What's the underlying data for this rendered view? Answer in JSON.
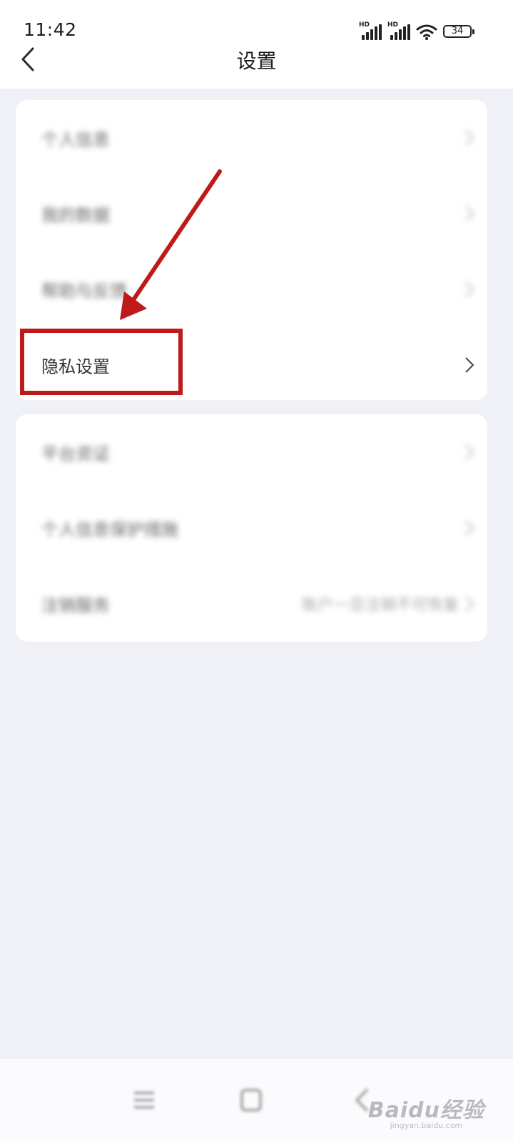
{
  "status_bar": {
    "time": "11:42",
    "battery": "34",
    "signal_label": "HD",
    "icons": [
      "hd-signal-icon",
      "hd-signal-icon",
      "wifi-icon",
      "battery-icon"
    ]
  },
  "header": {
    "title": "设置",
    "back_icon": "chevron-left-icon"
  },
  "settings": {
    "group1": [
      {
        "label": "个人信息"
      },
      {
        "label": "我的数据"
      },
      {
        "label": "帮助与反馈"
      },
      {
        "label": "隐私设置"
      }
    ],
    "group2": [
      {
        "label": "平台资证"
      },
      {
        "label": "个人信息保护措施"
      },
      {
        "label": "注销服务",
        "value": "账户一旦注销不可恢复"
      }
    ]
  },
  "annotation": {
    "highlighted_item": "隐私设置",
    "color": "#be1a1a"
  },
  "nav_bar": {
    "icons": [
      "menu-icon",
      "home-square-icon",
      "back-icon"
    ]
  },
  "watermark": {
    "logo": "Baidu经验",
    "url": "jingyan.baidu.com"
  }
}
